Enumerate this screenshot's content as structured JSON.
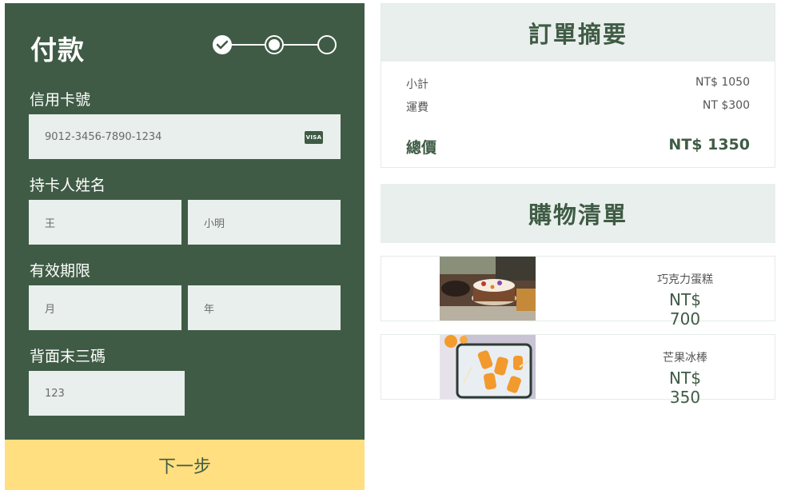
{
  "payment": {
    "title": "付款",
    "steps": [
      "done",
      "current",
      "pending"
    ],
    "card_number_label": "信用卡號",
    "card_number_value": "9012-3456-7890-1234",
    "card_brand": "VISA",
    "holder_label": "持卡人姓名",
    "last_name": "王",
    "first_name": "小明",
    "expiry_label": "有效期限",
    "month_placeholder": "月",
    "year_placeholder": "年",
    "cvv_label": "背面末三碼",
    "cvv_value": "123",
    "next_button": "下一步"
  },
  "summary": {
    "title": "訂單摘要",
    "subtotal_label": "小計",
    "subtotal_value": "NT$ 1050",
    "shipping_label": "運費",
    "shipping_value": "NT $300",
    "total_label": "總價",
    "total_value": "NT$ 1350"
  },
  "cart": {
    "title": "購物清單",
    "items": [
      {
        "name": "巧克力蛋糕",
        "price": "NT$ 700"
      },
      {
        "name": "芒果冰棒",
        "price": "NT$ 350"
      }
    ]
  },
  "colors": {
    "panel": "#3f5b45",
    "field": "#e8efec",
    "button": "#ffdf80"
  }
}
